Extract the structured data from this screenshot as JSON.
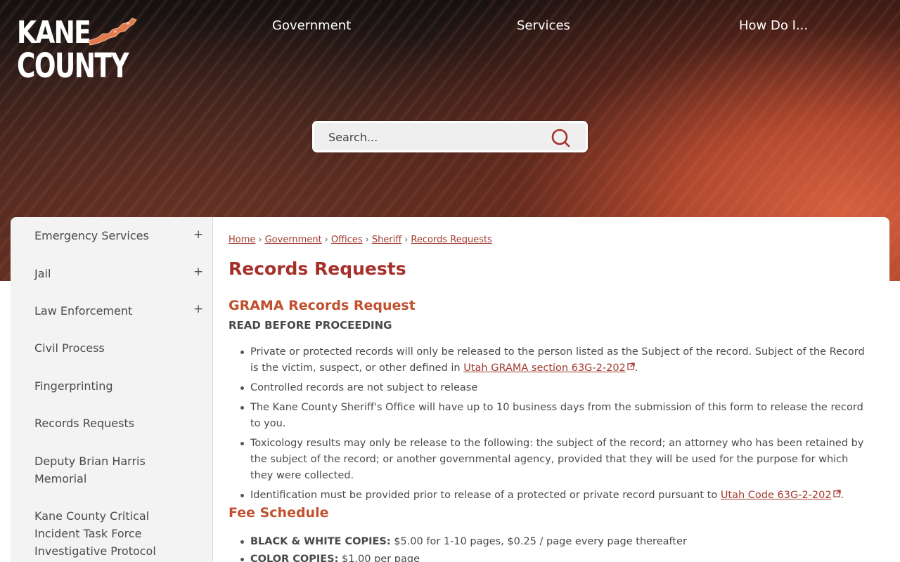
{
  "header": {
    "logo": {
      "line1": "KANE",
      "line2": "COUNTY"
    },
    "nav": [
      "Government",
      "Services",
      "How Do I..."
    ],
    "search": {
      "placeholder": "Search..."
    }
  },
  "sidebar": {
    "items": [
      {
        "label": "Emergency Services",
        "expandable": true
      },
      {
        "label": "Jail",
        "expandable": true
      },
      {
        "label": "Law Enforcement",
        "expandable": true
      },
      {
        "label": "Civil Process",
        "expandable": false
      },
      {
        "label": "Fingerprinting",
        "expandable": false
      },
      {
        "label": "Records Requests",
        "expandable": false
      },
      {
        "label": "Deputy Brian Harris Memorial",
        "expandable": false
      },
      {
        "label": "Kane County Critical Incident Task Force Investigative Protocol",
        "expandable": false
      }
    ],
    "expand_symbol": "+"
  },
  "breadcrumb": {
    "items": [
      "Home",
      "Government",
      "Offices",
      "Sheriff",
      "Records Requests"
    ],
    "separator": "›"
  },
  "content": {
    "title": "Records Requests",
    "grama_heading": "GRAMA Records Request",
    "read_before": "READ BEFORE PROCEEDING",
    "bullets": {
      "b1_text": "Private or protected records will only be released to the person listed as the Subject of the record. Subject of the Record is the victim, suspect, or other defined in ",
      "b1_link": "Utah GRAMA section 63G-2-202",
      "b1_end": ".",
      "b2": "Controlled records are not subject to release",
      "b3": "The Kane County Sheriff's Office will have up to 10 business days from the submission of this form to release the record to you.",
      "b4": "Toxicology results may only be release to the following: the subject of the record; an attorney who has been retained by the subject of the record; or another governmental agency, provided that they will be used for the purpose for which they were collected.",
      "b5_text": "Identification must be provided prior to release of a protected or private record pursuant to ",
      "b5_link": "Utah Code 63G-2-202",
      "b5_end": "."
    },
    "fee_heading": "Fee Schedule",
    "fees": [
      {
        "label": "BLACK & WHITE COPIES:",
        "value": " $5.00 for 1-10 pages, $0.25 / page every page thereafter"
      },
      {
        "label": "COLOR COPIES:",
        "value": " $1.00 per page"
      }
    ]
  },
  "colors": {
    "accent": "#a5302a",
    "heading": "#c0502e",
    "link": "#a13a2e",
    "sidebar_bg": "#f3f3f3"
  }
}
